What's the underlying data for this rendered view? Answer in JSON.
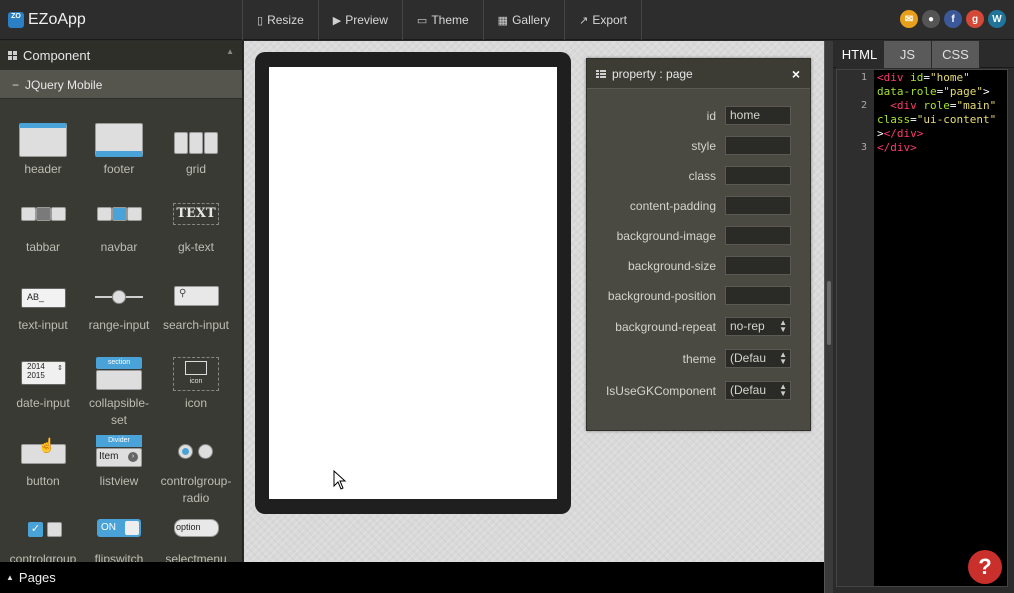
{
  "app": {
    "logo_text": "ZO",
    "title": "EZoApp"
  },
  "menu": [
    {
      "label": "Resize",
      "icon": "tablet-icon"
    },
    {
      "label": "Preview",
      "icon": "play-icon"
    },
    {
      "label": "Theme",
      "icon": "monitor-icon"
    },
    {
      "label": "Gallery",
      "icon": "gallery-icon"
    },
    {
      "label": "Export",
      "icon": "export-icon"
    }
  ],
  "social": [
    {
      "name": "mail-icon",
      "color": "#e8a01c",
      "glyph": "✉"
    },
    {
      "name": "github-icon",
      "color": "#555555",
      "glyph": "●"
    },
    {
      "name": "facebook-icon",
      "color": "#3b5998",
      "glyph": "f"
    },
    {
      "name": "google-plus-icon",
      "color": "#d34836",
      "glyph": "g"
    },
    {
      "name": "wordpress-icon",
      "color": "#21759b",
      "glyph": "W"
    }
  ],
  "left_panel": {
    "title": "Component",
    "section": "JQuery Mobile",
    "components": [
      {
        "label": "header",
        "icon": "header-icon"
      },
      {
        "label": "footer",
        "icon": "footer-icon"
      },
      {
        "label": "grid",
        "icon": "grid-icon"
      },
      {
        "label": "tabbar",
        "icon": "tabbar-icon"
      },
      {
        "label": "navbar",
        "icon": "navbar-icon"
      },
      {
        "label": "gk-text",
        "icon": "text-icon",
        "icon_text": "TEXT"
      },
      {
        "label": "text-input",
        "icon": "text-input-icon",
        "icon_text": "AB_"
      },
      {
        "label": "range-input",
        "icon": "range-input-icon"
      },
      {
        "label": "search-input",
        "icon": "search-input-icon"
      },
      {
        "label": "date-input",
        "icon": "date-input-icon",
        "icon_text": "2014 2015"
      },
      {
        "label": "collapsible-set",
        "icon": "collapsible-icon",
        "icon_text": "section"
      },
      {
        "label": "icon",
        "icon": "image-icon",
        "icon_text": "icon"
      },
      {
        "label": "button",
        "icon": "button-icon"
      },
      {
        "label": "listview",
        "icon": "listview-icon",
        "icon_text": "Divider",
        "icon_text2": "Item"
      },
      {
        "label": "controlgroup-radio",
        "icon": "radio-icon"
      },
      {
        "label": "controlgroup",
        "icon": "checkbox-icon"
      },
      {
        "label": "flipswitch",
        "icon": "flipswitch-icon",
        "icon_text": "ON"
      },
      {
        "label": "selectmenu",
        "icon": "selectmenu-icon",
        "icon_text": "option"
      }
    ]
  },
  "pages_bar": {
    "label": "Pages"
  },
  "property_panel": {
    "title": "property : page",
    "rows": [
      {
        "label": "id",
        "value": "home"
      },
      {
        "label": "style",
        "value": ""
      },
      {
        "label": "class",
        "value": ""
      },
      {
        "label": "content-padding",
        "value": ""
      },
      {
        "label": "background-image",
        "value": ""
      },
      {
        "label": "background-size",
        "value": ""
      },
      {
        "label": "background-position",
        "value": ""
      },
      {
        "label": "background-repeat",
        "value": "no-rep",
        "type": "select"
      },
      {
        "label": "theme",
        "value": "(Defau",
        "type": "select"
      },
      {
        "label": "IsUseGKComponent",
        "value": "(Defau",
        "type": "select"
      }
    ]
  },
  "code_panel": {
    "tabs": [
      "HTML",
      "JS",
      "CSS"
    ],
    "active_tab": "HTML",
    "line_numbers": [
      "1",
      "2",
      "3"
    ]
  },
  "help": {
    "label": "?"
  }
}
